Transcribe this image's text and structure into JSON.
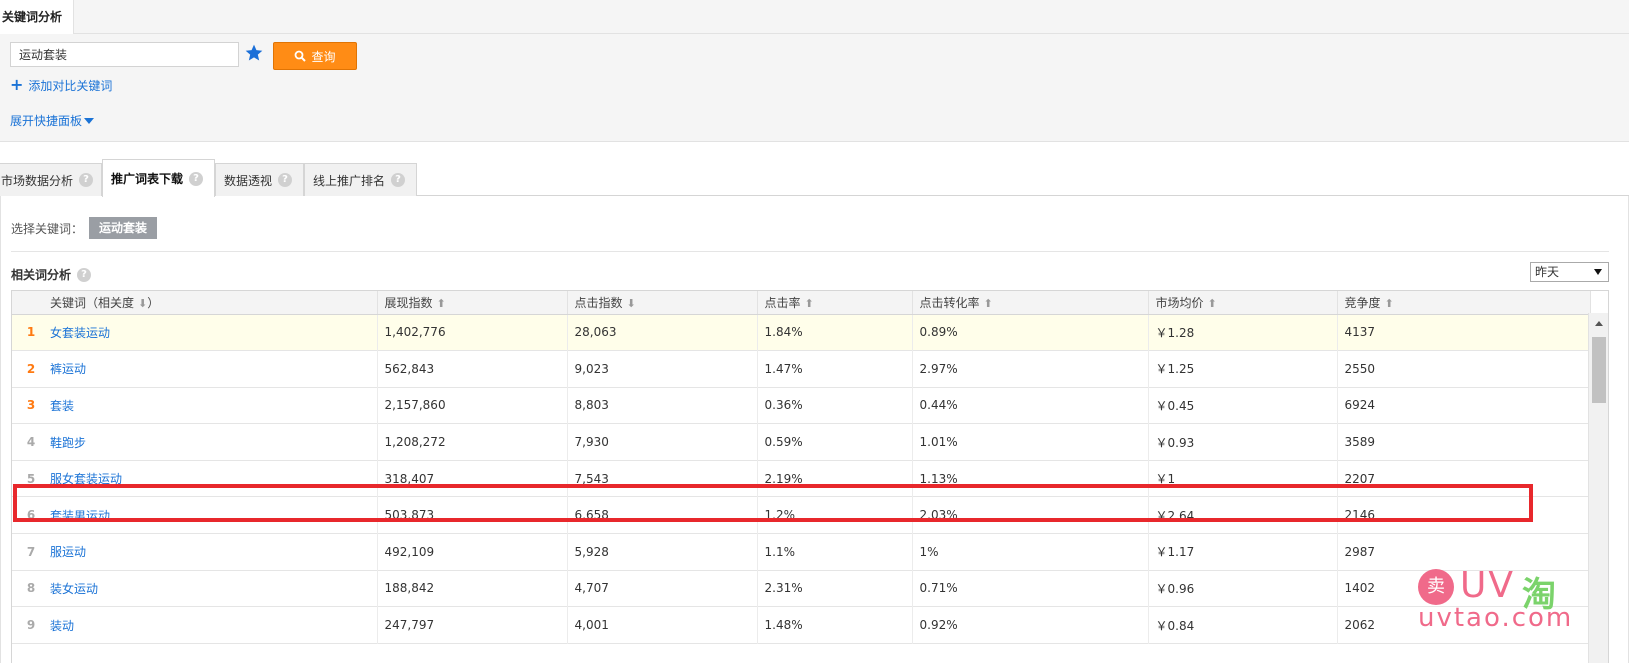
{
  "top_tab": {
    "label": "关键词分析"
  },
  "search": {
    "value": "运动套装",
    "query_label": "查询",
    "add_compare_label": "添加对比关键词",
    "expand_label": "展开快捷面板"
  },
  "module_tabs": [
    {
      "label": "市场数据分析",
      "active": false
    },
    {
      "label": "推广词表下载",
      "active": true
    },
    {
      "label": "数据透视",
      "active": false
    },
    {
      "label": "线上推广排名",
      "active": false
    }
  ],
  "keyword_select": {
    "label": "选择关键词：",
    "chip": "运动套装"
  },
  "section": {
    "title": "相关词分析",
    "date_value": "昨天"
  },
  "table": {
    "headers": [
      "关键词（相关度",
      "）",
      "展现指数",
      "点击指数",
      "点击率",
      "点击转化率",
      "市场均价",
      "竞争度"
    ],
    "rows": [
      {
        "rank": "1",
        "keyword": "女套装运动",
        "impr": "1,402,776",
        "clicks": "28,063",
        "ctr": "1.84%",
        "cvr": "0.89%",
        "price": "￥1.28",
        "comp": "4137"
      },
      {
        "rank": "2",
        "keyword": "裤运动",
        "impr": "562,843",
        "clicks": "9,023",
        "ctr": "1.47%",
        "cvr": "2.97%",
        "price": "￥1.25",
        "comp": "2550"
      },
      {
        "rank": "3",
        "keyword": "套装",
        "impr": "2,157,860",
        "clicks": "8,803",
        "ctr": "0.36%",
        "cvr": "0.44%",
        "price": "￥0.45",
        "comp": "6924"
      },
      {
        "rank": "4",
        "keyword": "鞋跑步",
        "impr": "1,208,272",
        "clicks": "7,930",
        "ctr": "0.59%",
        "cvr": "1.01%",
        "price": "￥0.93",
        "comp": "3589"
      },
      {
        "rank": "5",
        "keyword": "服女套装运动",
        "impr": "318,407",
        "clicks": "7,543",
        "ctr": "2.19%",
        "cvr": "1.13%",
        "price": "￥1",
        "comp": "2207"
      },
      {
        "rank": "6",
        "keyword": "套装男运动",
        "impr": "503,873",
        "clicks": "6,658",
        "ctr": "1.2%",
        "cvr": "2.03%",
        "price": "￥2.64",
        "comp": "2146"
      },
      {
        "rank": "7",
        "keyword": "服运动",
        "impr": "492,109",
        "clicks": "5,928",
        "ctr": "1.1%",
        "cvr": "1%",
        "price": "￥1.17",
        "comp": "2987"
      },
      {
        "rank": "8",
        "keyword": "装女运动",
        "impr": "188,842",
        "clicks": "4,707",
        "ctr": "2.31%",
        "cvr": "0.71%",
        "price": "￥0.96",
        "comp": "1402"
      },
      {
        "rank": "9",
        "keyword": "装动",
        "impr": "247,797",
        "clicks": "4,001",
        "ctr": "1.48%",
        "cvr": "0.92%",
        "price": "￥0.84",
        "comp": "2062"
      }
    ]
  },
  "watermark": {
    "badge": "卖",
    "uv": "UV",
    "tao": "淘",
    "domain": "uvtao.com"
  },
  "colors": {
    "accent_orange": "#ff8c15",
    "link_blue": "#1b73d6",
    "highlight_red": "#e8282c"
  }
}
